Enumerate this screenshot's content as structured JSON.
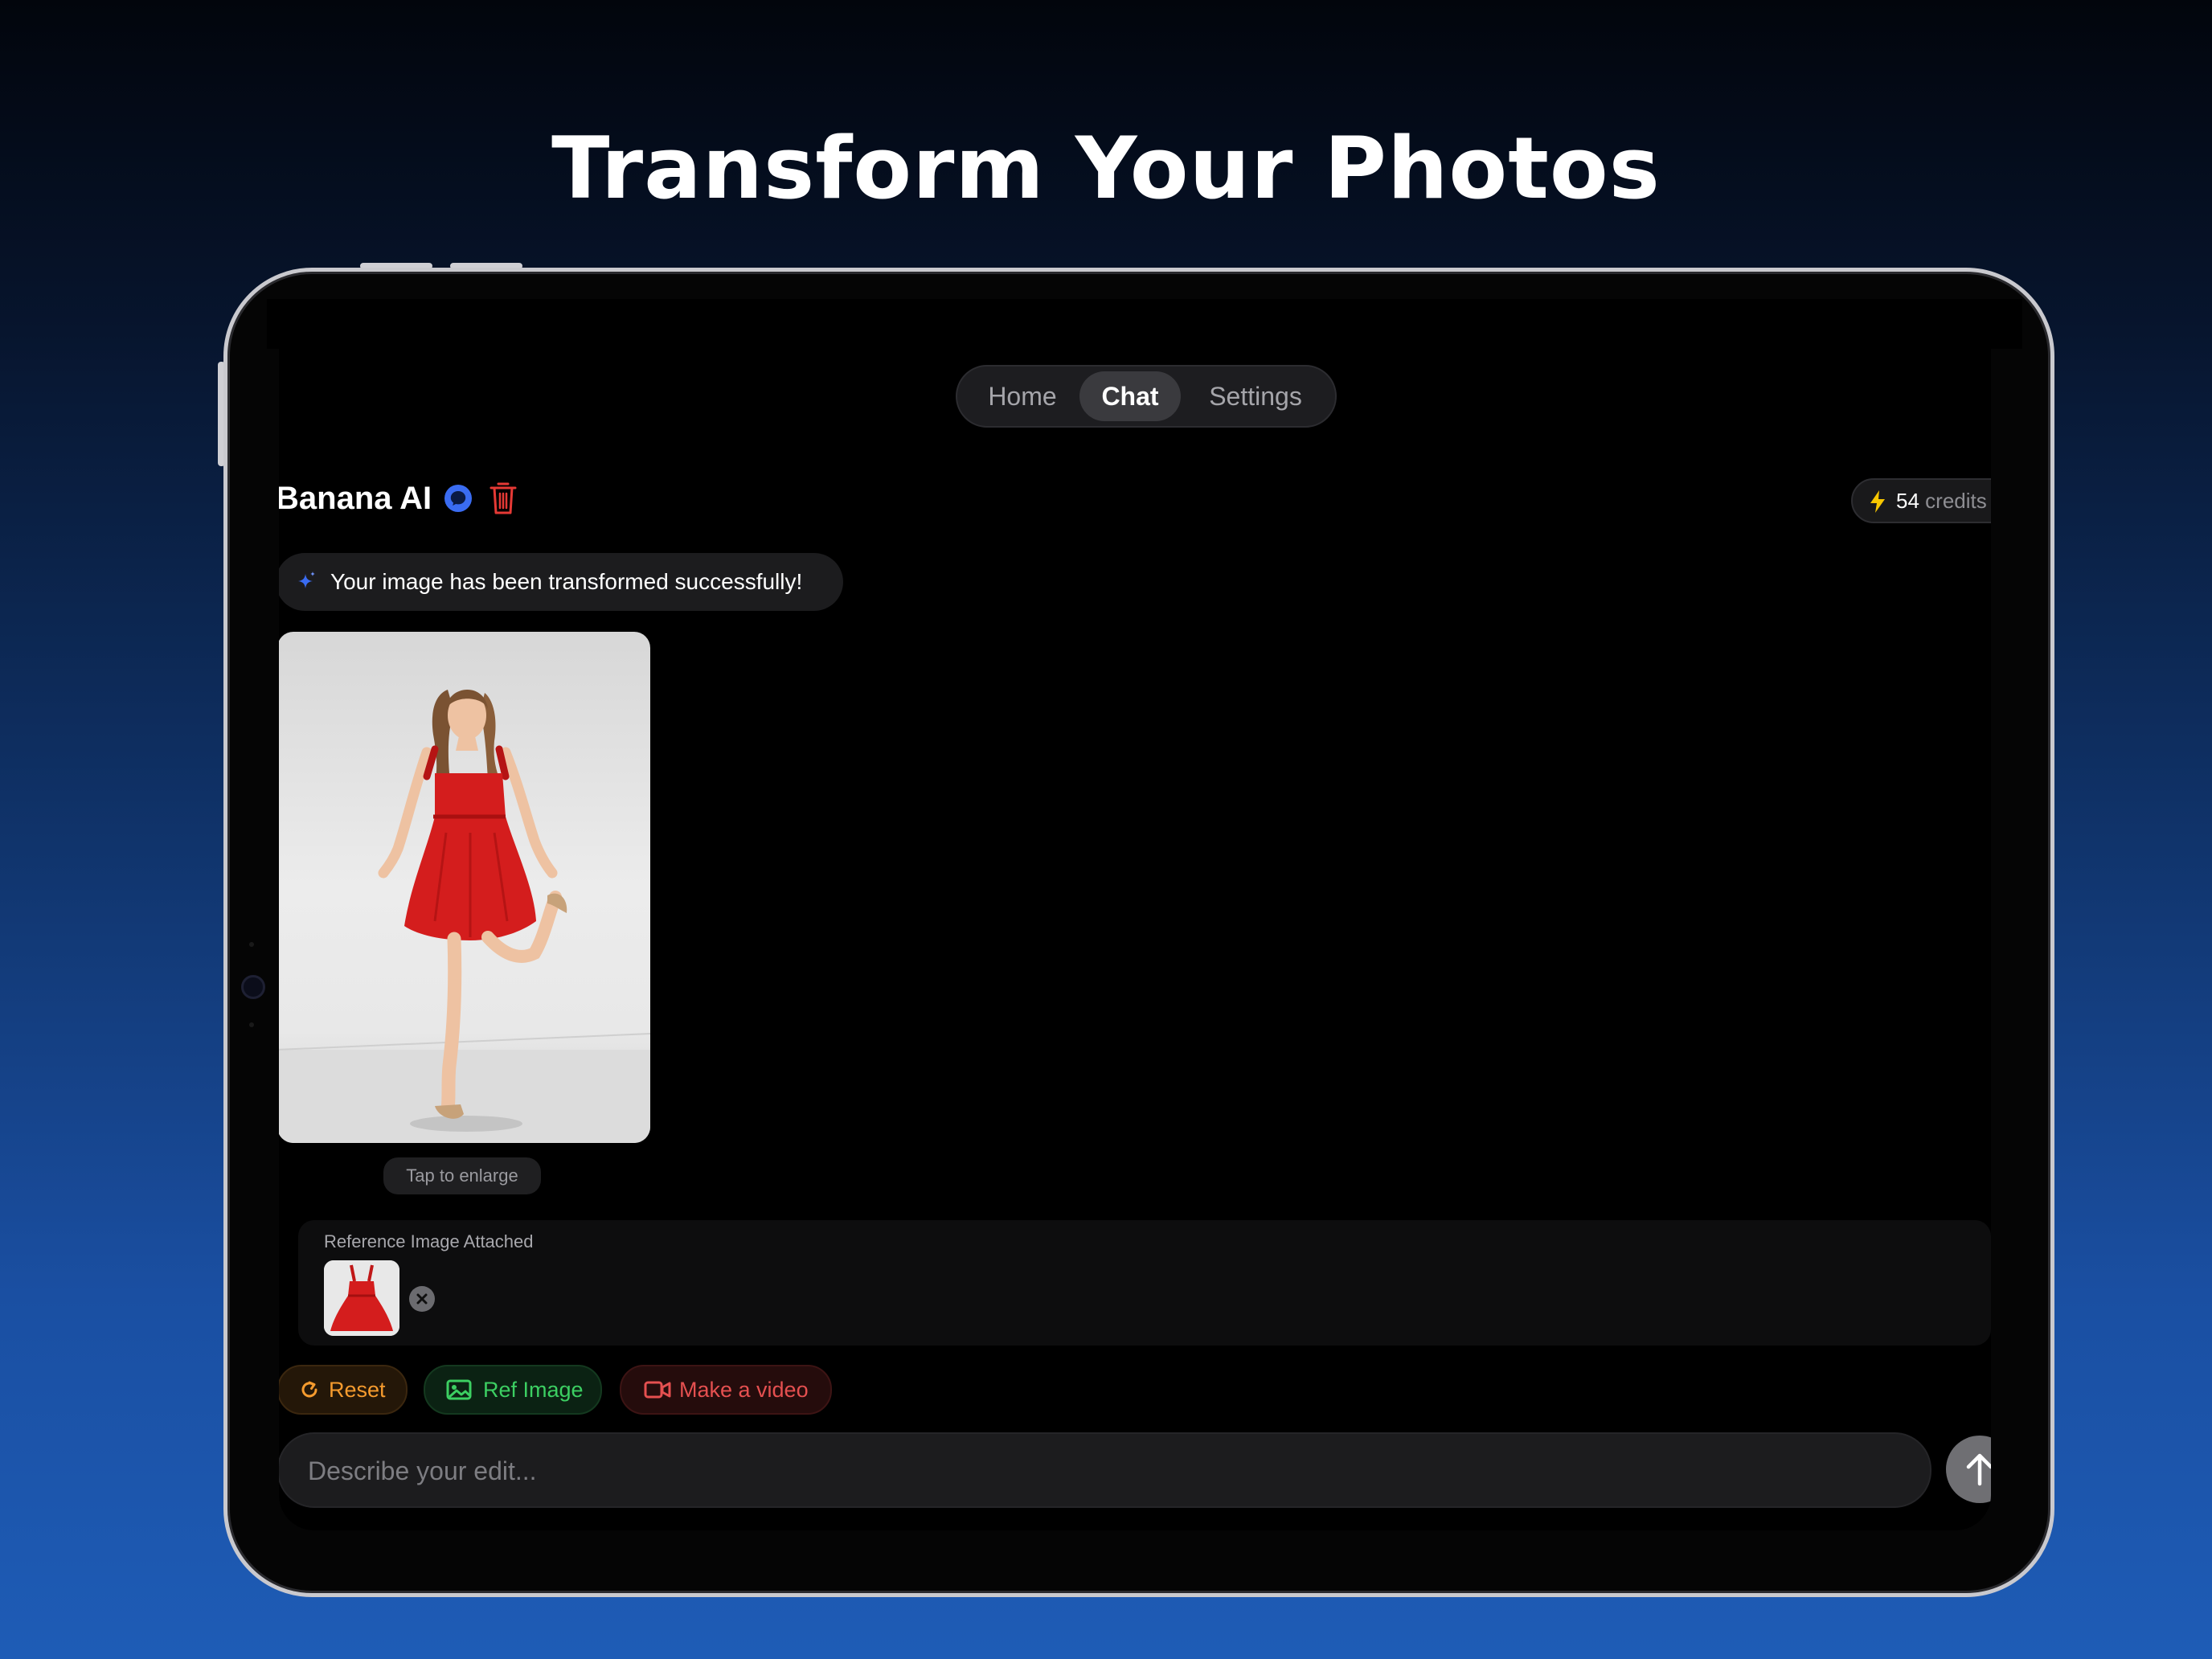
{
  "headline": "Transform Your Photos",
  "segmented": {
    "tabs": [
      "Home",
      "Chat",
      "Settings"
    ],
    "active": "Chat"
  },
  "header": {
    "title": "Banana AI",
    "credits_value": "54",
    "credits_unit": "credits"
  },
  "message": {
    "text": "Your image has been transformed successfully!"
  },
  "image": {
    "caption": "Tap to enlarge"
  },
  "reference": {
    "label": "Reference Image Attached"
  },
  "actions": {
    "reset": "Reset",
    "ref_image": "Ref Image",
    "make_video": "Make a video"
  },
  "composer": {
    "placeholder": "Describe your edit..."
  },
  "colors": {
    "accent_blue": "#3a6cf2",
    "delete_red": "#e53935",
    "reset_orange": "#f59b2e",
    "ref_green": "#3ccf62",
    "video_red": "#e55050",
    "bolt_yellow": "#f7c600",
    "dress_red": "#d41d1d"
  },
  "icons": [
    "chat-bubble-icon",
    "trash-icon",
    "lightning-icon",
    "sparkle-icon",
    "close-icon",
    "refresh-icon",
    "image-icon",
    "video-camera-icon",
    "arrow-up-icon"
  ]
}
